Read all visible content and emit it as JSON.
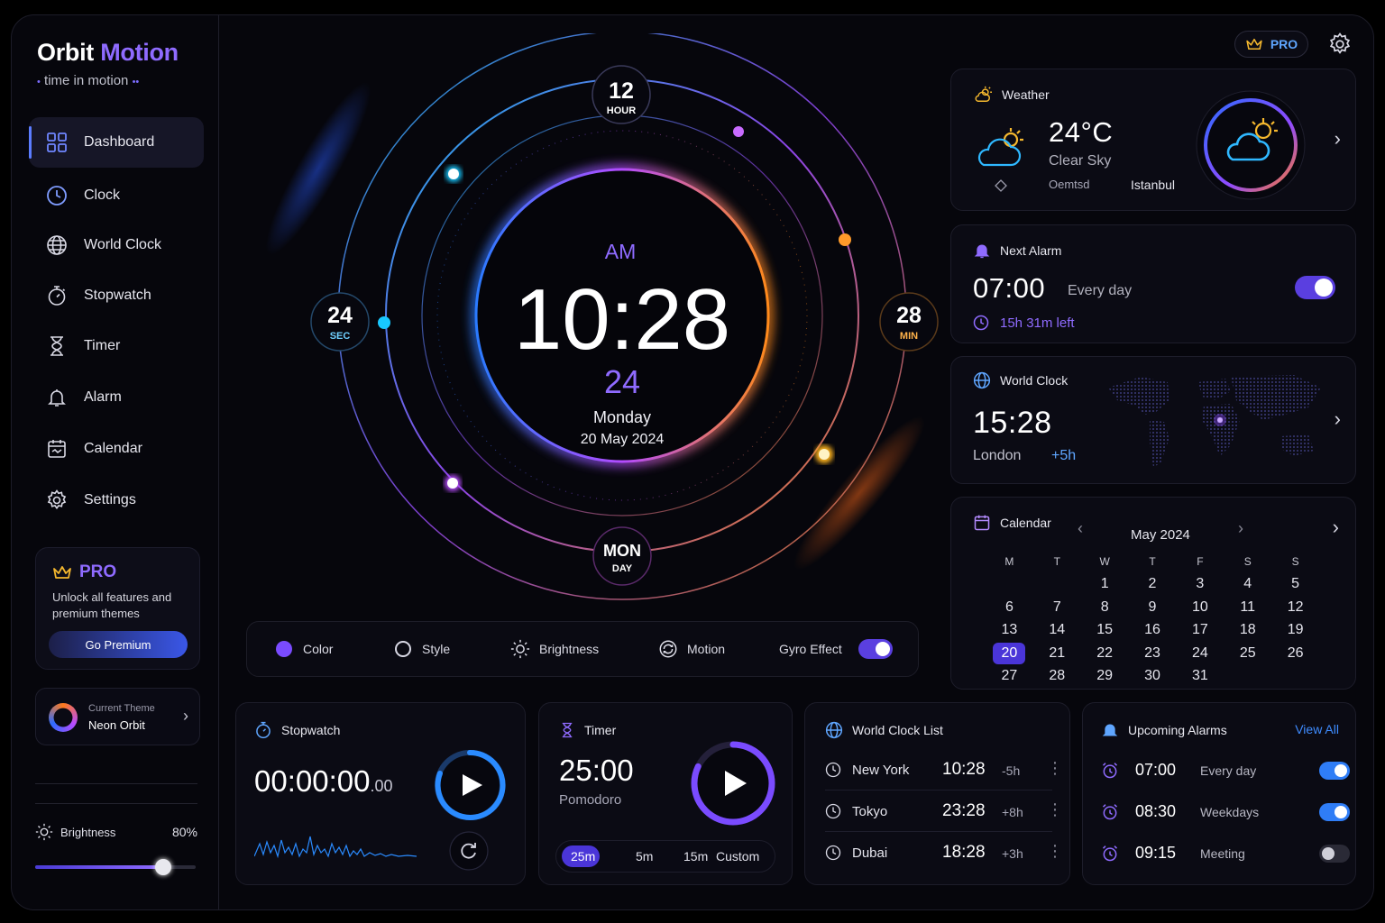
{
  "app": {
    "title_a": "Orbit",
    "title_b": "Motion",
    "tagline": "time in motion"
  },
  "nav": [
    {
      "label": "Dashboard",
      "icon": "grid-icon",
      "active": true
    },
    {
      "label": "Clock",
      "icon": "clock-icon"
    },
    {
      "label": "World Clock",
      "icon": "globe-icon"
    },
    {
      "label": "Stopwatch",
      "icon": "stopwatch-icon"
    },
    {
      "label": "Timer",
      "icon": "hourglass-icon"
    },
    {
      "label": "Alarm",
      "icon": "bell-icon"
    },
    {
      "label": "Calendar",
      "icon": "calendar-icon"
    },
    {
      "label": "Settings",
      "icon": "gear-icon"
    }
  ],
  "pro_card": {
    "title": "PRO",
    "desc": "Unlock all features and premium themes",
    "button": "Go Premium"
  },
  "theme": {
    "label": "Current Theme",
    "name": "Neon Orbit"
  },
  "brightness": {
    "label": "Brightness",
    "value_text": "80%",
    "value": 0.8
  },
  "topbar": {
    "pro": "PRO"
  },
  "clock": {
    "ampm": "AM",
    "time": "10:28",
    "seconds": "24",
    "weekday": "Monday",
    "date": "20 May 2024",
    "hour_badge": {
      "value": "12",
      "label": "HOUR"
    },
    "sec_badge": {
      "value": "24",
      "label": "SEC"
    },
    "min_badge": {
      "value": "28",
      "label": "MIN"
    },
    "day_badge": {
      "value": "MON",
      "label": "DAY"
    }
  },
  "controls": {
    "color": "Color",
    "style": "Style",
    "brightness": "Brightness",
    "motion": "Motion",
    "gyro": "Gyro Effect"
  },
  "weather": {
    "title": "Weather",
    "temp": "24°C",
    "condition": "Clear Sky",
    "sub_left": "Oemtsd",
    "city": "Istanbul"
  },
  "next_alarm": {
    "title": "Next Alarm",
    "time": "07:00",
    "repeat": "Every day",
    "left": "15h 31m left"
  },
  "world_clock": {
    "title": "World Clock",
    "time": "15:28",
    "city": "London",
    "offset": "+5h"
  },
  "calendar": {
    "title": "Calendar",
    "month": "May 2024",
    "weekdays": [
      "M",
      "T",
      "W",
      "T",
      "F",
      "S",
      "S"
    ],
    "weeks": [
      [
        "",
        "",
        "1",
        "2",
        "3",
        "4",
        "5"
      ],
      [
        "6",
        "7",
        "8",
        "9",
        "10",
        "11",
        "12"
      ],
      [
        "13",
        "14",
        "15",
        "16",
        "17",
        "18",
        "19"
      ],
      [
        "20",
        "21",
        "22",
        "23",
        "24",
        "25",
        "26"
      ],
      [
        "27",
        "28",
        "29",
        "30",
        "31",
        "",
        ""
      ]
    ],
    "selected": "20"
  },
  "stopwatch": {
    "title": "Stopwatch",
    "time": "00:00:00",
    "ms": ".00"
  },
  "timer": {
    "title": "Timer",
    "time": "25:00",
    "mode": "Pomodoro",
    "presets": [
      "25m",
      "5m",
      "15m",
      "Custom"
    ],
    "progress": 0.82
  },
  "world_list": {
    "title": "World Clock List",
    "items": [
      {
        "city": "New York",
        "time": "10:28",
        "offset": "-5h"
      },
      {
        "city": "Tokyo",
        "time": "23:28",
        "offset": "+8h"
      },
      {
        "city": "Dubai",
        "time": "18:28",
        "offset": "+3h"
      }
    ]
  },
  "alarms": {
    "title": "Upcoming Alarms",
    "view_all": "View All",
    "items": [
      {
        "time": "07:00",
        "label": "Every day",
        "on": true
      },
      {
        "time": "08:30",
        "label": "Weekdays",
        "on": true
      },
      {
        "time": "09:15",
        "label": "Meeting",
        "on": false
      }
    ]
  },
  "colors": {
    "accent": "#8f6bff",
    "blue": "#2f7df6",
    "orange": "#ff8a1a",
    "cyan": "#18c8ff"
  }
}
